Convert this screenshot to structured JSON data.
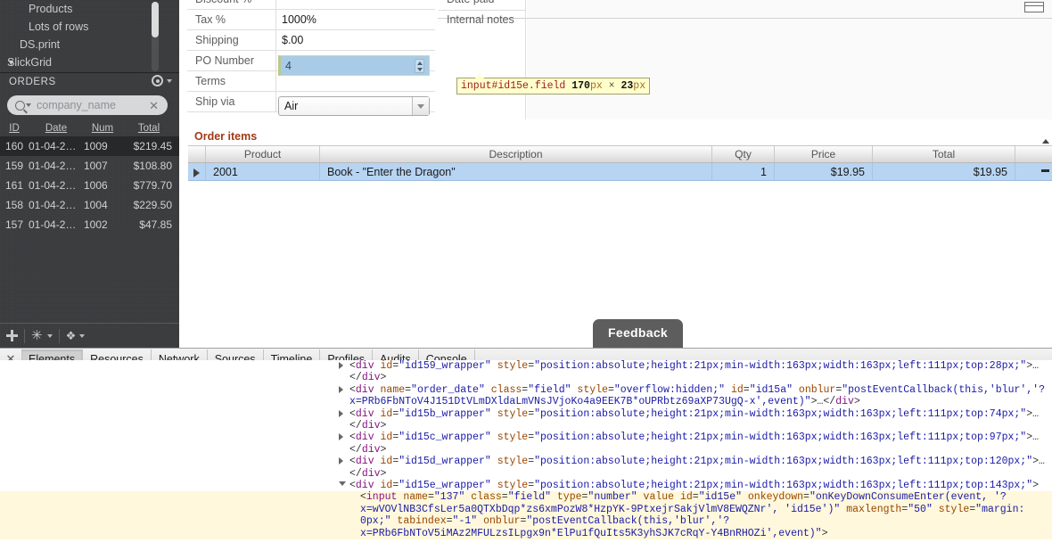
{
  "sidebar": {
    "tree": [
      {
        "label": "Products",
        "level": 2,
        "caret": ""
      },
      {
        "label": "Lots of rows",
        "level": 2,
        "caret": ""
      },
      {
        "label": "DS.print",
        "level": 1,
        "caret": ""
      },
      {
        "label": "SlickGrid",
        "level": 0,
        "caret": "▼"
      }
    ],
    "orders_title": "ORDERS",
    "search": {
      "value": "company_name",
      "clear": "✕"
    },
    "grid": {
      "columns": [
        "ID",
        "Date",
        "Num",
        "Total"
      ],
      "rows": [
        {
          "id": "160",
          "date": "01-04-2…",
          "num": "1009",
          "total": "$219.45",
          "selected": true
        },
        {
          "id": "159",
          "date": "01-04-2…",
          "num": "1007",
          "total": "$108.80",
          "selected": false
        },
        {
          "id": "161",
          "date": "01-04-2…",
          "num": "1006",
          "total": "$779.70",
          "selected": false
        },
        {
          "id": "158",
          "date": "01-04-2…",
          "num": "1004",
          "total": "$229.50",
          "selected": false
        },
        {
          "id": "157",
          "date": "01-04-2…",
          "num": "1002",
          "total": "$47.85",
          "selected": false
        }
      ]
    },
    "toolbar": {
      "add": "+",
      "star": "✳",
      "diamond": "❖"
    }
  },
  "form": {
    "left_rows": [
      {
        "label": "Discount %",
        "value": ""
      },
      {
        "label": "Tax %",
        "value": "1000%"
      },
      {
        "label": "Shipping",
        "value": "$.00"
      },
      {
        "label": "PO Number",
        "value": ""
      },
      {
        "label": "Terms",
        "value": ""
      },
      {
        "label": "Ship via",
        "value": ""
      }
    ],
    "right_rows": [
      {
        "label": "Date paid",
        "value": ""
      },
      {
        "label": "Internal notes",
        "value": ""
      }
    ],
    "po_number_value": "4",
    "ship_via_value": "Air"
  },
  "tooltip": {
    "selector": "input#id15e.field",
    "width": "170",
    "width_unit": "px",
    "times": "×",
    "height": "23",
    "height_unit": "px"
  },
  "order_items": {
    "title": "Order items",
    "columns": [
      "",
      "Product",
      "Description",
      "Qty",
      "Price",
      "Total"
    ],
    "rows": [
      {
        "expander": "▶",
        "product": "2001",
        "description": "Book - \"Enter the Dragon\"",
        "qty": "1",
        "price": "$19.95",
        "total": "$19.95"
      }
    ]
  },
  "feedback": {
    "label": "Feedback"
  },
  "devtools": {
    "close": "✕",
    "tabs": [
      {
        "label": "Elements",
        "active": true
      },
      {
        "label": "Resources",
        "active": false
      },
      {
        "label": "Network",
        "active": false
      },
      {
        "label": "Sources",
        "active": false
      },
      {
        "label": "Timeline",
        "active": false
      },
      {
        "label": "Profiles",
        "active": false
      },
      {
        "label": "Audits",
        "active": false
      },
      {
        "label": "Console",
        "active": false
      }
    ],
    "nodes": [
      {
        "tri": "right",
        "tag": "div",
        "attrs": [
          {
            "name": "id",
            "value": "id159_wrapper"
          },
          {
            "name": "style",
            "value": "position:absolute;height:21px;min-width:163px;width:163px;left:111px;top:28px;"
          }
        ],
        "ellipsis": "…"
      },
      {
        "tri": "right",
        "tag": "div",
        "attrs": [
          {
            "name": "name",
            "value": "order_date"
          },
          {
            "name": "class",
            "value": "field"
          },
          {
            "name": "style",
            "value": "overflow:hidden;"
          },
          {
            "name": "id",
            "value": "id15a"
          },
          {
            "name": "onblur",
            "value": "postEventCallback(this,'blur','?x=PRb6FbNToV4J151DtVLmDXldaLmVNsJVjoKo4a9EEK7B*oUPRbtz69aXP73UgQ-x',event)"
          }
        ],
        "ellipsis": "…"
      },
      {
        "tri": "right",
        "tag": "div",
        "attrs": [
          {
            "name": "id",
            "value": "id15b_wrapper"
          },
          {
            "name": "style",
            "value": "position:absolute;height:21px;min-width:163px;width:163px;left:111px;top:74px;"
          }
        ],
        "ellipsis": "…"
      },
      {
        "tri": "right",
        "tag": "div",
        "attrs": [
          {
            "name": "id",
            "value": "id15c_wrapper"
          },
          {
            "name": "style",
            "value": "position:absolute;height:21px;min-width:163px;width:163px;left:111px;top:97px;"
          }
        ],
        "ellipsis": "…"
      },
      {
        "tri": "right",
        "tag": "div",
        "attrs": [
          {
            "name": "id",
            "value": "id15d_wrapper"
          },
          {
            "name": "style",
            "value": "position:absolute;height:21px;min-width:163px;width:163px;left:111px;top:120px;"
          }
        ],
        "ellipsis": "…"
      },
      {
        "tri": "down",
        "tag": "div",
        "attrs": [
          {
            "name": "id",
            "value": "id15e_wrapper"
          },
          {
            "name": "style",
            "value": "position:absolute;height:21px;min-width:163px;width:163px;left:111px;top:143px;"
          }
        ],
        "ellipsis": ""
      }
    ],
    "selected_child": {
      "tag": "input",
      "attrs": [
        {
          "name": "name",
          "value": "137"
        },
        {
          "name": "class",
          "value": "field"
        },
        {
          "name": "type",
          "value": "number"
        },
        {
          "name": "value",
          "value": null
        },
        {
          "name": "id",
          "value": "id15e"
        },
        {
          "name": "onkeydown",
          "value": "onKeyDownConsumeEnter(event, '?x=wVOVlNB3CfsLer5a0QTXbDqp*zs6xmPozW8*HzpYK-9PtxejrSakjVlmV8EWQZNr', 'id15e')"
        },
        {
          "name": "maxlength",
          "value": "50"
        },
        {
          "name": "style",
          "value": "margin: 0px;"
        },
        {
          "name": "tabindex",
          "value": "-1"
        },
        {
          "name": "onblur",
          "value": "postEventCallback(this,'blur','?x=PRb6FbNToV5iMAz2MFULzsILpgx9n*ElPu1fQuIts5K3yhSJK7cRqY-Y4BnRHOZi',event)"
        }
      ]
    }
  }
}
